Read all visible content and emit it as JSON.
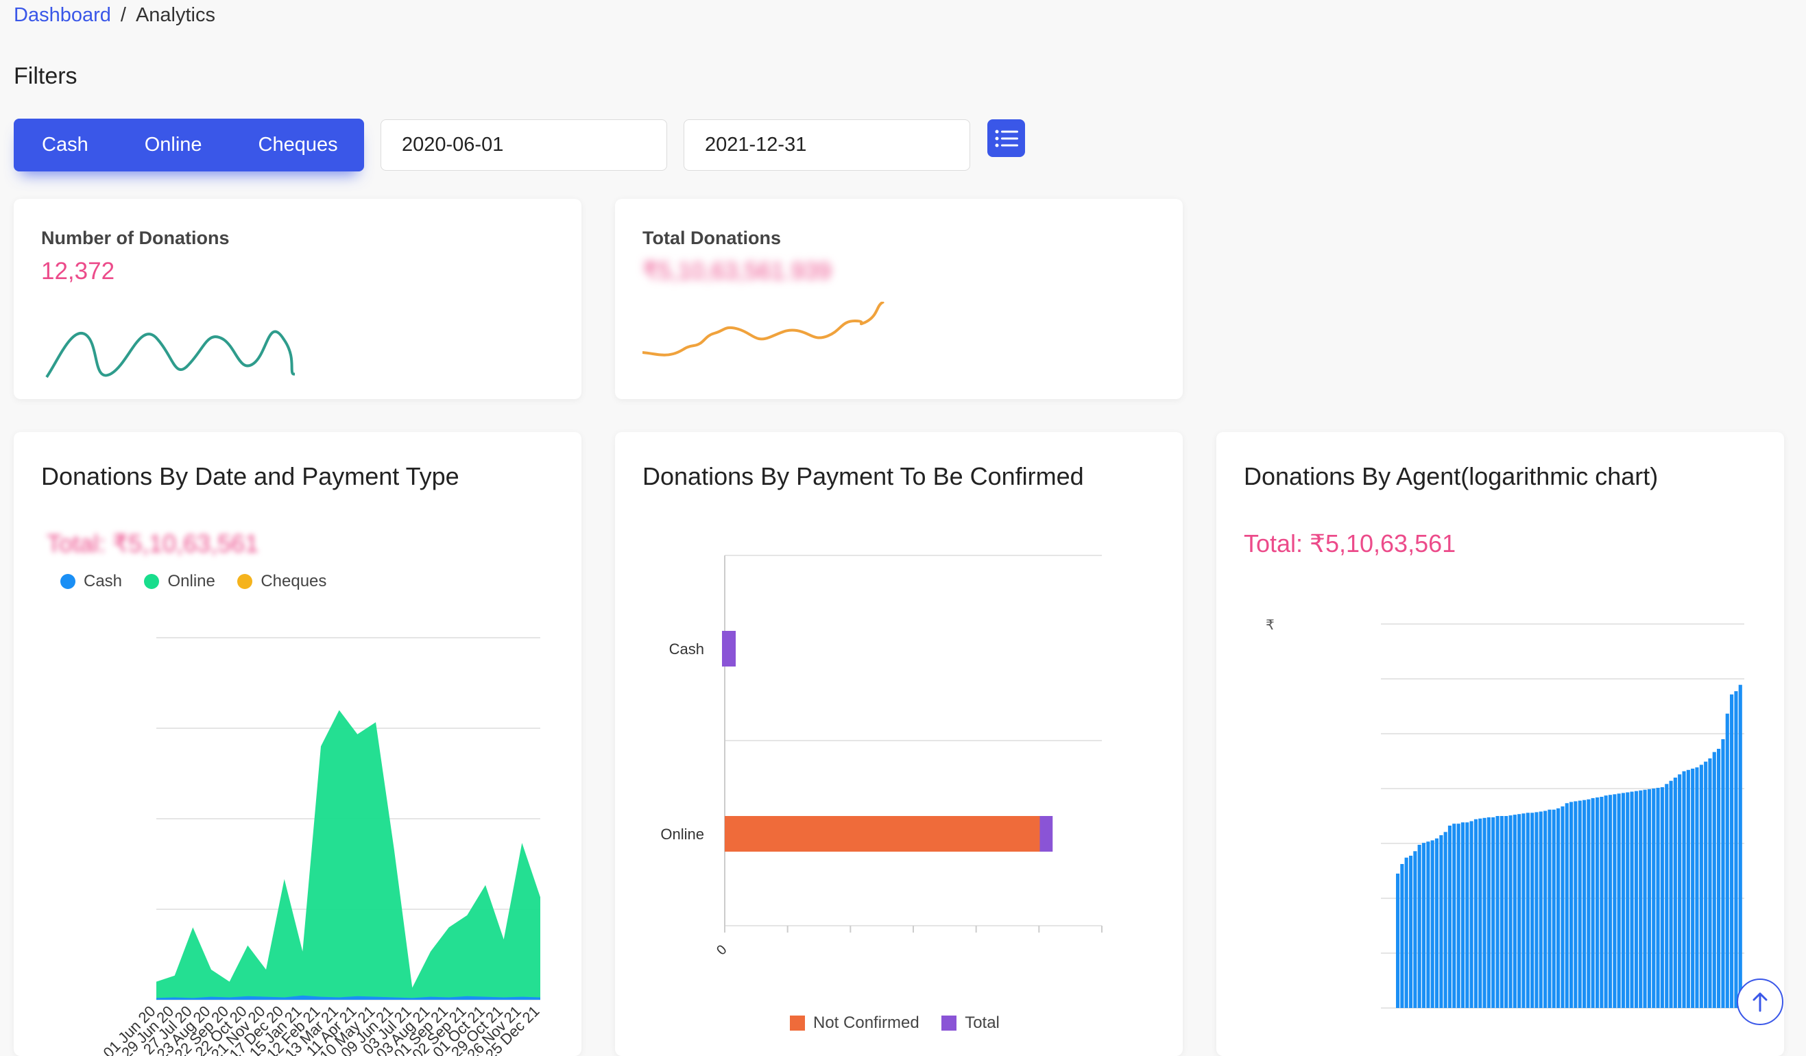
{
  "breadcrumb": {
    "home": "Dashboard",
    "separator": "/",
    "current": "Analytics"
  },
  "filters": {
    "title": "Filters",
    "payment_types": [
      "Cash",
      "Online",
      "Cheques"
    ],
    "start_date": "2020-06-01",
    "end_date": "2021-12-31",
    "list_icon": "list-icon"
  },
  "stats": [
    {
      "label": "Number of Donations",
      "value": "12,372",
      "sparkline_color": "#2e9c8c"
    },
    {
      "label": "Total Donations",
      "value": "₹5,10,63,561.939",
      "sparkline_color": "#f0a23c"
    }
  ],
  "charts": {
    "by_date": {
      "title": "Donations By Date and Payment Type",
      "total": "Total: ₹5,10,63,561",
      "legend": [
        {
          "name": "Cash",
          "color": "#1a8ff5"
        },
        {
          "name": "Online",
          "color": "#18dd8c"
        },
        {
          "name": "Cheques",
          "color": "#f5b31c"
        }
      ]
    },
    "by_confirm": {
      "title": "Donations By Payment To Be Confirmed",
      "legend": [
        {
          "name": "Not Confirmed",
          "color": "#ef6b3a"
        },
        {
          "name": "Total",
          "color": "#8a54d6"
        }
      ]
    },
    "by_agent": {
      "title": "Donations By Agent(logarithmic chart)",
      "total": "Total: ₹5,10,63,561",
      "bar_color": "#1a8ff5"
    }
  },
  "chart_data": [
    {
      "type": "area",
      "title": "Donations By Date and Payment Type",
      "categories": [
        "01 Jun 20",
        "29 Jun 20",
        "27 Jul 20",
        "23 Aug 20",
        "22 Sep 20",
        "22 Oct 20",
        "21 Nov 20",
        "17 Dec 20",
        "15 Jan 21",
        "12 Feb 21",
        "13 Mar 21",
        "11 Apr 21",
        "10 May 21",
        "09 Jun 21",
        "03 Jul 21",
        "03 Aug 21",
        "01 Sep 21",
        "02 Sep 21",
        "01 Oct 21",
        "29 Oct 21",
        "26 Nov 21",
        "25 Dec 21"
      ],
      "series": [
        {
          "name": "Cash",
          "values": [
            0.3,
            0.4,
            0.3,
            0.5,
            0.4,
            0.6,
            0.5,
            0.4,
            0.7,
            0.5,
            0.4,
            0.6,
            0.5,
            0.4,
            0.3,
            0.5,
            0.4,
            0.6,
            0.5,
            0.4,
            0.5,
            0.4
          ]
        },
        {
          "name": "Online",
          "values": [
            3,
            4,
            12,
            5,
            3,
            9,
            5,
            20,
            8,
            42,
            48,
            44,
            46,
            25,
            2,
            8,
            12,
            14,
            19,
            10,
            26,
            17
          ]
        },
        {
          "name": "Cheques",
          "values": [
            0,
            0,
            0,
            0,
            0,
            0,
            0,
            0,
            0,
            0,
            0,
            0,
            0,
            0,
            0,
            0,
            0,
            0,
            0,
            0,
            0,
            0
          ]
        }
      ],
      "ylim": [
        0,
        60
      ]
    },
    {
      "type": "bar",
      "orientation": "horizontal",
      "title": "Donations By Payment To Be Confirmed",
      "categories": [
        "Cash",
        "Online"
      ],
      "series": [
        {
          "name": "Not Confirmed",
          "values": [
            0,
            49000000
          ]
        },
        {
          "name": "Total",
          "values": [
            1850000,
            51000000
          ]
        }
      ],
      "x_ticks": [
        "0"
      ]
    },
    {
      "type": "bar",
      "title": "Donations By Agent(logarithmic chart)",
      "y_scale": "log",
      "y_top_tick_prefix": "₹",
      "values": [
        3.1,
        3.25,
        3.35,
        3.38,
        3.45,
        3.55,
        3.58,
        3.6,
        3.62,
        3.65,
        3.7,
        3.75,
        3.85,
        3.88,
        3.88,
        3.9,
        3.9,
        3.92,
        3.95,
        3.96,
        3.97,
        3.98,
        3.98,
        4.0,
        4.0,
        4.0,
        4.01,
        4.02,
        4.03,
        4.04,
        4.05,
        4.05,
        4.06,
        4.07,
        4.08,
        4.1,
        4.1,
        4.12,
        4.15,
        4.2,
        4.22,
        4.23,
        4.24,
        4.25,
        4.26,
        4.28,
        4.29,
        4.3,
        4.32,
        4.33,
        4.34,
        4.35,
        4.36,
        4.37,
        4.38,
        4.39,
        4.4,
        4.41,
        4.42,
        4.43,
        4.44,
        4.45,
        4.5,
        4.55,
        4.6,
        4.65,
        4.7,
        4.72,
        4.74,
        4.76,
        4.8,
        4.85,
        4.9,
        5.0,
        5.05,
        5.2,
        5.6,
        5.9,
        5.95,
        6.05
      ]
    }
  ]
}
